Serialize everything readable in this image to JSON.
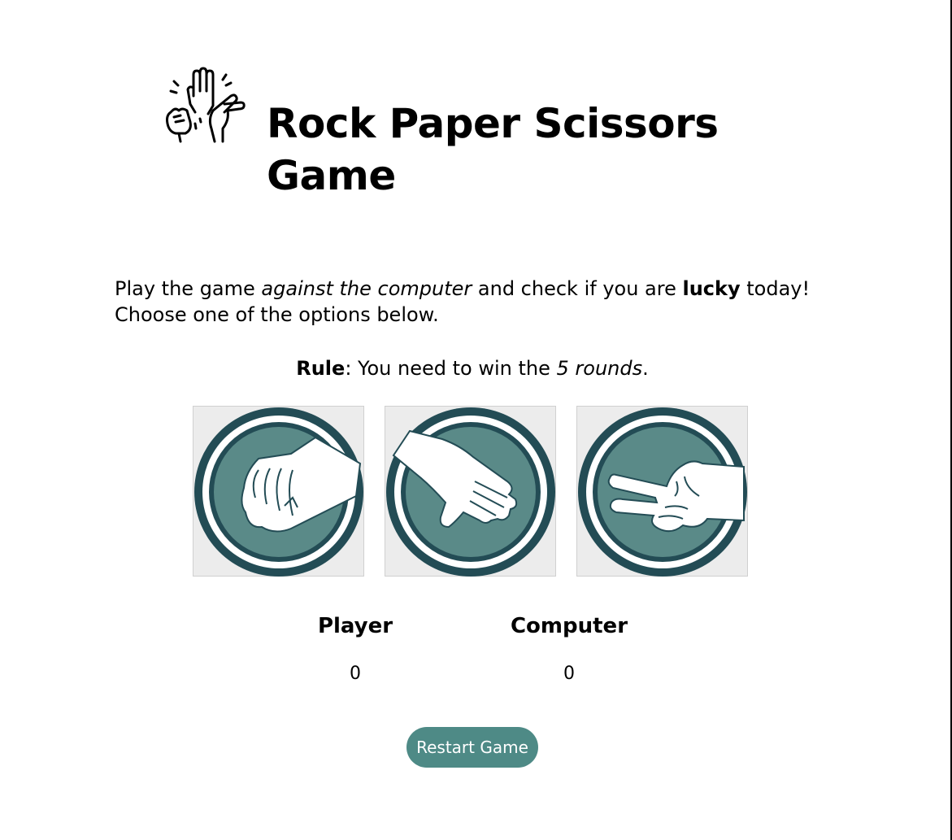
{
  "header": {
    "logo_icon": "hands-rock-paper-scissors-icon",
    "title": "Rock Paper Scissors Game"
  },
  "intro": {
    "part1": "Play the game ",
    "emphasis": "against the computer",
    "part2": " and check if you are ",
    "strong": "lucky",
    "part3": " today!",
    "line2": "Choose one of the options below."
  },
  "rule": {
    "label": "Rule",
    "text": ": You need to win the ",
    "emphasis": "5 rounds",
    "end": "."
  },
  "choices": [
    {
      "name": "rock",
      "icon": "rock-fist-icon"
    },
    {
      "name": "paper",
      "icon": "paper-hand-icon"
    },
    {
      "name": "scissors",
      "icon": "scissors-hand-icon"
    }
  ],
  "scores": {
    "player_label": "Player",
    "player_value": "0",
    "computer_label": "Computer",
    "computer_value": "0"
  },
  "restart_label": "Restart Game",
  "colors": {
    "accent": "#4e8a86",
    "circle_dark": "#234c55",
    "circle_fill": "#5a8a88",
    "tile_bg": "#ececec"
  }
}
